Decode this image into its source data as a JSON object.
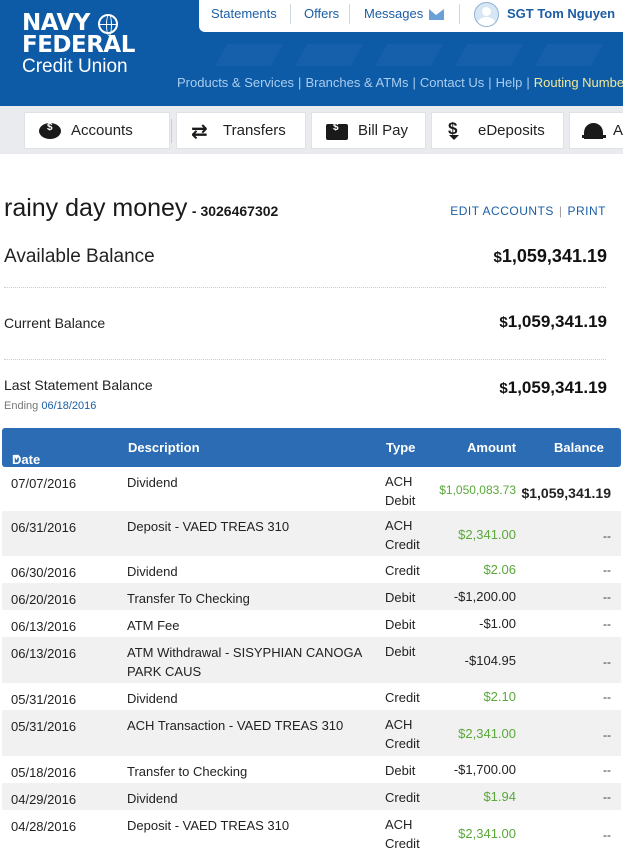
{
  "brand": {
    "line1": "NAVY",
    "line2": "FEDERAL",
    "line3": "Credit Union"
  },
  "topbar": {
    "statements": "Statements",
    "offers": "Offers",
    "messages": "Messages",
    "user": "SGT Tom Nguyen"
  },
  "nav": [
    "Products & Services",
    "Branches & ATMs",
    "Contact Us",
    "Help",
    "Routing Number"
  ],
  "tabs": [
    "Accounts",
    "Transfers",
    "Bill Pay",
    "eDeposits",
    "A"
  ],
  "account": {
    "name": "rainy day money",
    "number": "- 3026467302",
    "edit": "EDIT ACCOUNTS",
    "print": "PRINT",
    "available_label": "Available Balance",
    "available_value": "1,059,341.19",
    "current_label": "Current Balance",
    "current_value": "1,059,341.19",
    "statement_label": "Last Statement Balance",
    "statement_value": "1,059,341.19",
    "currency": "$",
    "ending_label": "Ending",
    "ending_date": "06/18/2016"
  },
  "table": {
    "headers": {
      "date": "Date",
      "description": "Description",
      "type": "Type",
      "amount": "Amount",
      "balance": "Balance"
    },
    "rows": [
      {
        "date": "07/07/2016",
        "desc": "Dividend",
        "type": "ACH Debit",
        "amount": "$1,050,083.73",
        "balance": "$1,059,341.19",
        "credit": true
      },
      {
        "date": "06/31/2016",
        "desc": "Deposit - VAED TREAS 310",
        "type": "ACH Credit",
        "amount": "$2,341.00",
        "balance": "--",
        "credit": true
      },
      {
        "date": "06/30/2016",
        "desc": "Dividend",
        "type": "Credit",
        "amount": "$2.06",
        "balance": "--",
        "credit": true
      },
      {
        "date": "06/20/2016",
        "desc": "Transfer To Checking",
        "type": "Debit",
        "amount": "-$1,200.00",
        "balance": "--",
        "credit": false
      },
      {
        "date": "06/13/2016",
        "desc": "ATM Fee",
        "type": "Debit",
        "amount": "-$1.00",
        "balance": "--",
        "credit": false
      },
      {
        "date": "06/13/2016",
        "desc": "ATM Withdrawal - SISYPHIAN CANOGA PARK CAUS",
        "type": "Debit",
        "amount": "-$104.95",
        "balance": "--",
        "credit": false
      },
      {
        "date": "05/31/2016",
        "desc": "Dividend",
        "type": "Credit",
        "amount": "$2.10",
        "balance": "--",
        "credit": true
      },
      {
        "date": "05/31/2016",
        "desc": "ACH Transaction - VAED TREAS 310",
        "type": "ACH Credit",
        "amount": "$2,341.00",
        "balance": "--",
        "credit": true
      },
      {
        "date": "05/18/2016",
        "desc": "Transfer to Checking",
        "type": "Debit",
        "amount": "-$1,700.00",
        "balance": "--",
        "credit": false
      },
      {
        "date": "04/29/2016",
        "desc": "Dividend",
        "type": "Credit",
        "amount": "$1.94",
        "balance": "--",
        "credit": true
      },
      {
        "date": "04/28/2016",
        "desc": "Deposit - VAED TREAS 310",
        "type": "ACH Credit",
        "amount": "$2,341.00",
        "balance": "--",
        "credit": true
      }
    ]
  }
}
